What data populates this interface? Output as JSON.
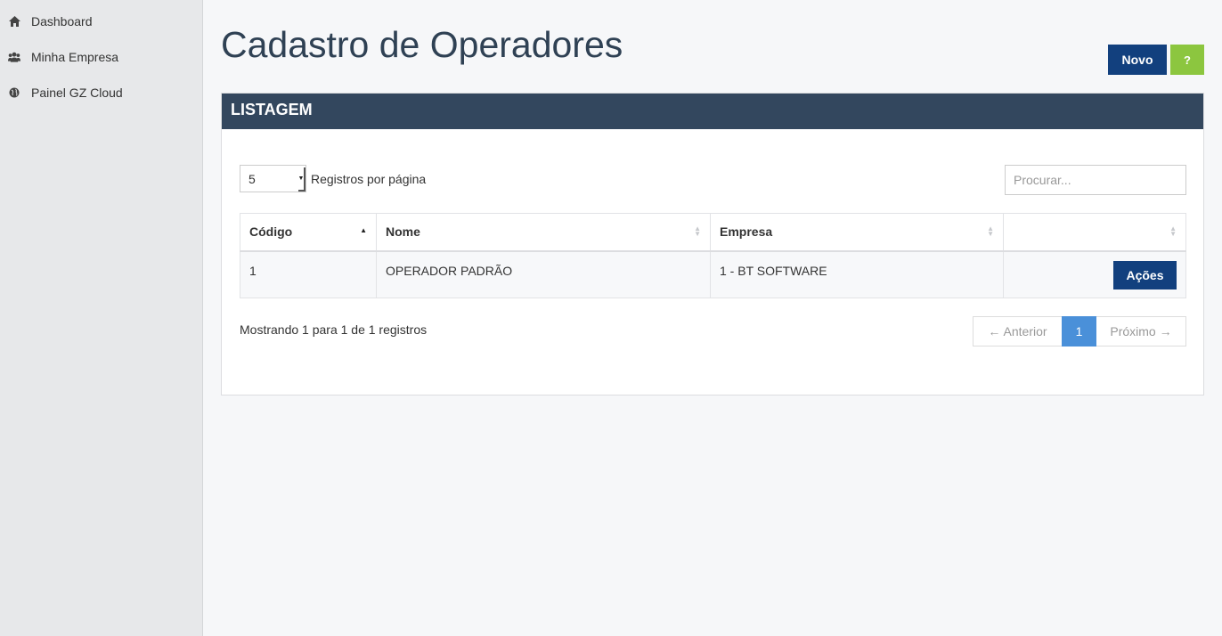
{
  "sidebar": {
    "items": [
      {
        "label": "Dashboard",
        "icon": "home-icon"
      },
      {
        "label": "Minha Empresa",
        "icon": "users-icon"
      },
      {
        "label": "Painel GZ Cloud",
        "icon": "globe-icon"
      }
    ]
  },
  "header": {
    "title": "Cadastro de Operadores",
    "novo_label": "Novo",
    "help_label": "?"
  },
  "panel": {
    "title": "LISTAGEM",
    "per_page_value": "5",
    "per_page_label": "Registros por página",
    "search_placeholder": "Procurar..."
  },
  "table": {
    "columns": [
      "Código",
      "Nome",
      "Empresa",
      ""
    ],
    "rows": [
      {
        "codigo": "1",
        "nome": "OPERADOR PADRÃO",
        "empresa": "1 - BT SOFTWARE",
        "action_label": "Ações"
      }
    ]
  },
  "footer": {
    "info": "Mostrando 1 para 1 de 1 registros",
    "prev_label": "← Anterior",
    "current_page": "1",
    "next_label": "Próximo →"
  },
  "colors": {
    "primary": "#12407e",
    "help": "#8cc63f",
    "panel_header": "#33475e",
    "page_active": "#4a90d9"
  }
}
